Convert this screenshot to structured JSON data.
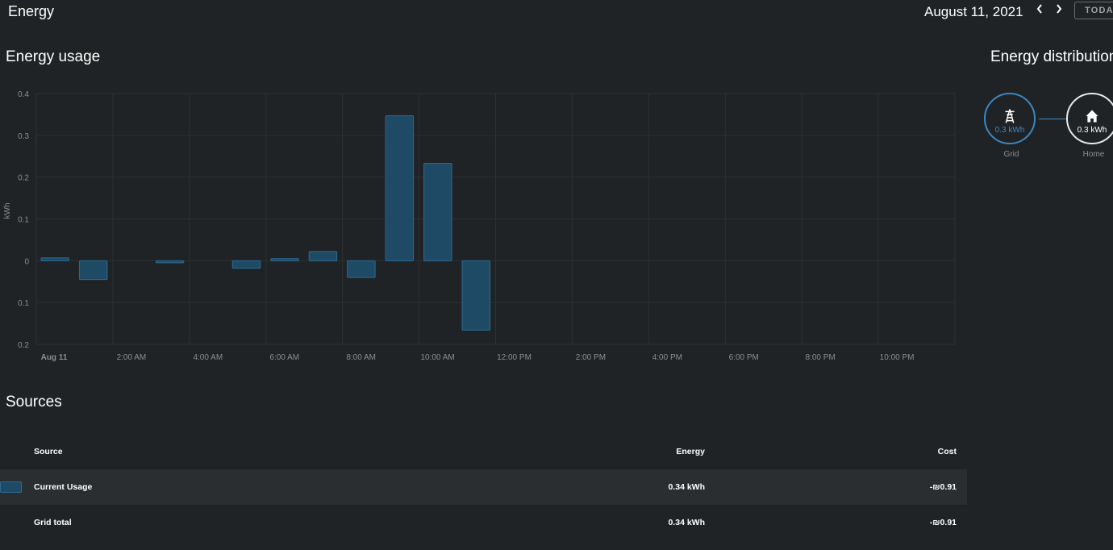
{
  "header": {
    "title": "Energy",
    "date": "August 11, 2021",
    "prev_icon": "chevron-left-icon",
    "next_icon": "chevron-right-icon",
    "today_label": "TODAY"
  },
  "sections": {
    "usage_title": "Energy usage",
    "distribution_title": "Energy distribution",
    "sources_title": "Sources"
  },
  "colors": {
    "background": "#202325",
    "bar_fill": "#1e4a66",
    "bar_stroke": "#2d6a92",
    "grid_accent": "#3c88c4",
    "home_accent": "#e9e9e9"
  },
  "chart_data": {
    "type": "bar",
    "ylabel": "kWh",
    "ylim": [
      -0.2,
      0.4
    ],
    "y_tick_labels": [
      "0.4",
      "0.3",
      "0.2",
      "0.1",
      "0",
      "0.1",
      "0.2"
    ],
    "x_tick_labels": [
      "Aug 11",
      "2:00 AM",
      "4:00 AM",
      "6:00 AM",
      "8:00 AM",
      "10:00 AM",
      "12:00 PM",
      "2:00 PM",
      "4:00 PM",
      "6:00 PM",
      "8:00 PM",
      "10:00 PM"
    ],
    "categories": [
      "12:00 AM",
      "1:00 AM",
      "2:00 AM",
      "3:00 AM",
      "4:00 AM",
      "5:00 AM",
      "6:00 AM",
      "7:00 AM",
      "8:00 AM",
      "9:00 AM",
      "10:00 AM",
      "11:00 AM",
      "12:00 PM",
      "1:00 PM",
      "2:00 PM",
      "3:00 PM",
      "4:00 PM",
      "5:00 PM",
      "6:00 PM",
      "7:00 PM",
      "8:00 PM",
      "9:00 PM",
      "10:00 PM",
      "11:00 PM"
    ],
    "values": [
      0.007,
      -0.045,
      0,
      -0.005,
      0,
      -0.018,
      0.005,
      0.022,
      -0.04,
      0.347,
      0.233,
      -0.166,
      0,
      0,
      0,
      0,
      0,
      0,
      0,
      0,
      0,
      0,
      0,
      0
    ],
    "grid": true
  },
  "distribution": {
    "grid": {
      "icon": "transmission-tower-icon",
      "value": "0.3 kWh",
      "label": "Grid"
    },
    "home": {
      "icon": "home-icon",
      "value": "0.3 kWh",
      "label": "Home"
    }
  },
  "sources_table": {
    "headers": {
      "source": "Source",
      "energy": "Energy",
      "cost": "Cost"
    },
    "rows": [
      {
        "source": "Current Usage",
        "energy": "0.34 kWh",
        "cost": "-₪0.91"
      }
    ],
    "total": {
      "source": "Grid total",
      "energy": "0.34 kWh",
      "cost": "-₪0.91"
    }
  }
}
